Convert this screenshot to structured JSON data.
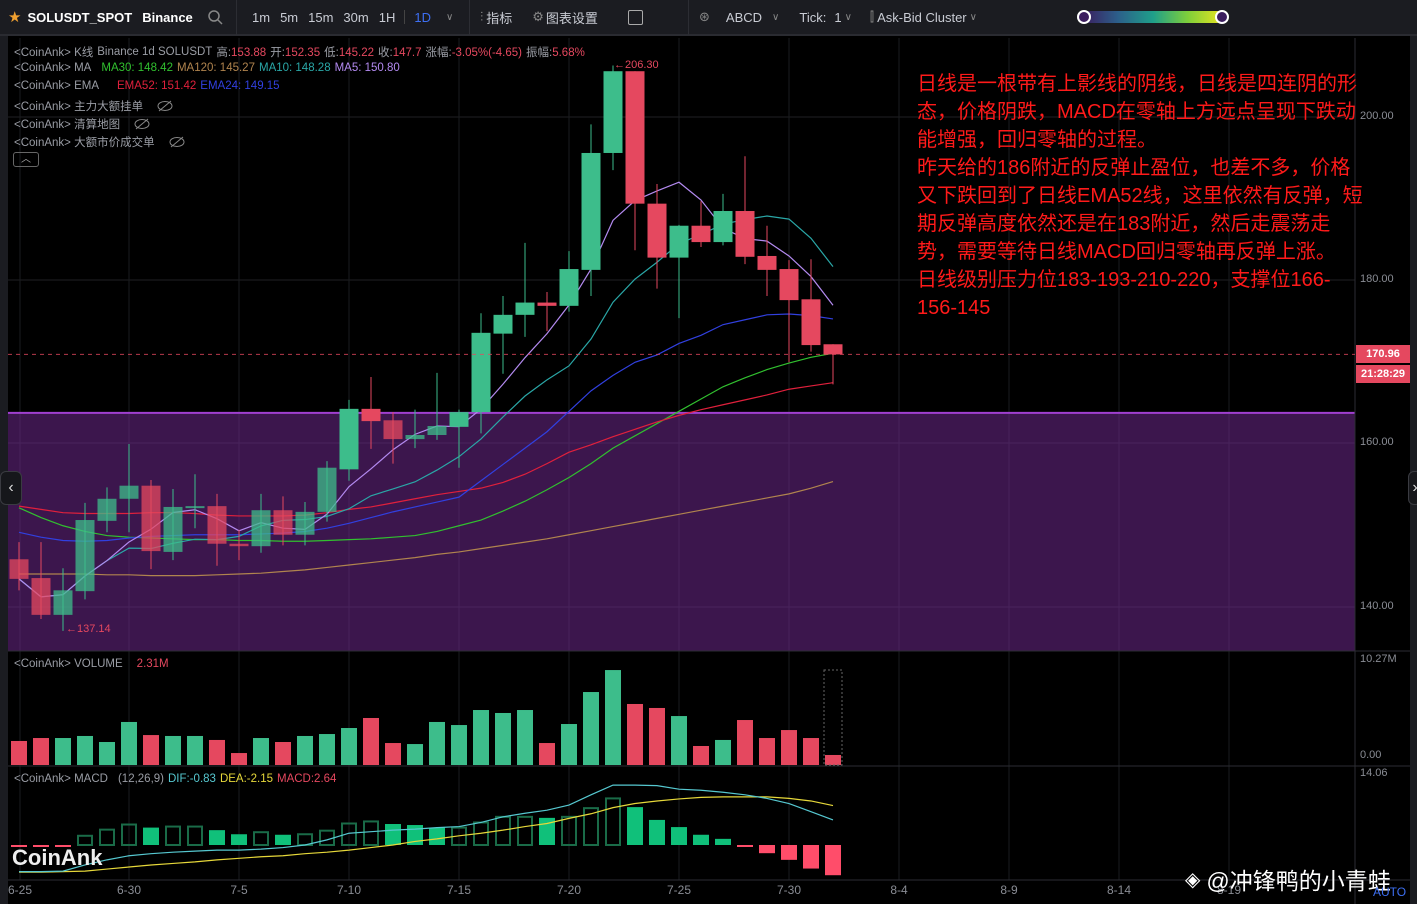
{
  "toolbar": {
    "symbol": "SOLUSDT_SPOT",
    "exchange": "Binance",
    "timeframes": [
      "1m",
      "5m",
      "15m",
      "30m",
      "1H"
    ],
    "active_timeframe": "1D",
    "indicators": "指标",
    "chart_settings": "图表设置",
    "abcd": "ABCD",
    "tick_label": "Tick:",
    "tick_value": "1",
    "cluster": "Ask-Bid Cluster"
  },
  "legend": {
    "kline": {
      "prefix": "<CoinAnk> K线",
      "src": "Binance 1d SOLUSDT",
      "high_l": "高:",
      "high": "153.88",
      "open_l": "开:",
      "open": "152.35",
      "low_l": "低:",
      "low": "145.22",
      "close_l": "收:",
      "close": "147.7",
      "chg_l": "涨幅:",
      "chg": "-3.05%(-4.65)",
      "amp_l": "振幅:",
      "amp": "5.68%"
    },
    "ma": {
      "prefix": "<CoinAnk> MA",
      "ma30": "MA30: 148.42",
      "ma120": "MA120: 145.27",
      "ma10": "MA10: 148.28",
      "ma5": "MA5: 150.80"
    },
    "ema": {
      "prefix": "<CoinAnk> EMA",
      "ema52": "EMA52: 151.42",
      "ema24": "EMA24: 149.15"
    },
    "hidden": [
      "<CoinAnk> 主力大额挂单",
      "<CoinAnk> 清算地图",
      "<CoinAnk> 大额市价成交单"
    ],
    "volume": {
      "prefix": "<CoinAnk> VOLUME",
      "value": "2.31M"
    },
    "macd": {
      "prefix": "<CoinAnk> MACD",
      "params": "(12,26,9)",
      "dif": "DIF:-0.83",
      "dea": "DEA:-2.15",
      "macd": "MACD:2.64"
    }
  },
  "price_axis": [
    "200.00",
    "180.00",
    "160.00",
    "140.00"
  ],
  "volume_axis": [
    "10.27M",
    "0.00"
  ],
  "macd_axis": [
    "14.06"
  ],
  "current_price": "170.96",
  "countdown": "21:28:29",
  "max_marker": "←206.30",
  "min_marker": "←137.14",
  "dates": [
    "6-25",
    "6-30",
    "7-5",
    "7-10",
    "7-15",
    "7-20",
    "7-25",
    "7-30",
    "8-4",
    "8-9",
    "8-14",
    "8-19"
  ],
  "annotation": [
    "日线是一根带有上影线的阴线，日线是四连阴的形态，价格阴跌，MACD在零轴上方远点呈现下跌动能增强，回归零轴的过程。",
    "昨天给的186附近的反弹止盈位，也差不多，价格又下跌回到了日线EMA52线，这里依然有反弹，短期反弹高度依然还是在183附近，然后走震荡走势，需要等待日线MACD回归零轴再反弹上涨。",
    "日线级别压力位183-193-210-220，支撑位166-156-145"
  ],
  "watermark": "CoinAnk",
  "author": "@冲锋鸭的小青蛙",
  "auto": "AUTO",
  "colors": {
    "up": "#3dbd8b",
    "down": "#e5485f",
    "ma5": "#b38af0",
    "ma10": "#2aa7a7",
    "ma30": "#31c02f",
    "ma120": "#b0844e",
    "ema52": "#e0203c",
    "ema24": "#3140e0",
    "dif": "#56c8d0",
    "dea": "#e6d83a",
    "zone": "#a040d0"
  },
  "chart_data": {
    "type": "candlestick",
    "first_date": "6-25",
    "zone_top": 163.8,
    "ohlc": [
      [
        145.9,
        148.0,
        142.1,
        143.5
      ],
      [
        143.6,
        148.0,
        138.6,
        139.1
      ],
      [
        139.1,
        144.8,
        137.14,
        142.1
      ],
      [
        142.0,
        152.8,
        141.0,
        150.7
      ],
      [
        150.6,
        154.7,
        149.2,
        153.3
      ],
      [
        153.3,
        160.0,
        149.2,
        154.9
      ],
      [
        154.9,
        155.6,
        144.7,
        146.9
      ],
      [
        146.8,
        154.5,
        145.8,
        152.3
      ],
      [
        152.4,
        156.3,
        149.7,
        152.4
      ],
      [
        152.4,
        153.9,
        145.1,
        147.8
      ],
      [
        147.8,
        149.5,
        145.8,
        147.5
      ],
      [
        147.5,
        153.9,
        146.7,
        151.9
      ],
      [
        151.9,
        153.6,
        147.6,
        148.9
      ],
      [
        148.9,
        152.9,
        147.6,
        151.7
      ],
      [
        151.7,
        157.9,
        150.5,
        157.1
      ],
      [
        156.9,
        165.4,
        155.5,
        164.3
      ],
      [
        164.3,
        168.2,
        159.4,
        162.8
      ],
      [
        162.9,
        163.9,
        157.6,
        160.6
      ],
      [
        160.6,
        164.2,
        159.5,
        161.1
      ],
      [
        161.1,
        168.7,
        160.5,
        162.2
      ],
      [
        162.1,
        164.2,
        157.1,
        163.9
      ],
      [
        163.9,
        176.0,
        161.3,
        173.6
      ],
      [
        173.5,
        178.1,
        168.6,
        175.8
      ],
      [
        175.8,
        184.6,
        173.1,
        177.3
      ],
      [
        177.3,
        178.6,
        173.8,
        176.9
      ],
      [
        176.9,
        183.6,
        176.2,
        181.4
      ],
      [
        181.3,
        199.1,
        178.1,
        195.6
      ],
      [
        195.6,
        206.3,
        193.5,
        205.6
      ],
      [
        205.6,
        205.6,
        183.7,
        189.4
      ],
      [
        189.4,
        191.8,
        179.0,
        182.8
      ],
      [
        182.8,
        186.8,
        175.4,
        186.7
      ],
      [
        186.7,
        189.7,
        184.1,
        184.7
      ],
      [
        184.7,
        190.6,
        184.3,
        188.5
      ],
      [
        188.5,
        195.2,
        182.0,
        182.9
      ],
      [
        183.0,
        186.7,
        178.1,
        181.3
      ],
      [
        181.4,
        182.5,
        170.0,
        177.6
      ],
      [
        177.7,
        182.6,
        171.3,
        172.1
      ],
      [
        172.2,
        172.2,
        167.3,
        170.96
      ]
    ],
    "volume_m": [
      2.35,
      2.64,
      2.64,
      2.84,
      2.25,
      4.21,
      2.93,
      2.84,
      2.84,
      2.45,
      1.17,
      2.64,
      2.25,
      2.84,
      3.03,
      3.62,
      4.6,
      2.15,
      2.05,
      4.21,
      3.91,
      5.38,
      5.09,
      5.38,
      2.15,
      4.01,
      7.14,
      9.29,
      5.97,
      5.58,
      4.79,
      1.86,
      2.45,
      4.4,
      2.64,
      3.42,
      2.64,
      0.98
    ],
    "ma30": [
      152.2,
      151.0,
      150.0,
      149.3,
      148.8,
      148.6,
      148.5,
      148.4,
      148.3,
      148.3,
      148.2,
      148.2,
      148.1,
      148.1,
      148.2,
      148.3,
      148.4,
      148.6,
      148.8,
      149.3,
      150.0,
      150.7,
      151.8,
      153.0,
      154.4,
      155.9,
      157.6,
      159.5,
      161.0,
      162.5,
      164.0,
      165.5,
      167.0,
      168.1,
      169.1,
      169.9,
      170.6,
      171.1
    ],
    "ma120": [
      144.1,
      144.1,
      144.1,
      144.1,
      144.0,
      144.0,
      143.9,
      143.9,
      143.9,
      144.0,
      144.1,
      144.2,
      144.4,
      144.6,
      144.9,
      145.2,
      145.5,
      145.8,
      146.1,
      146.5,
      146.8,
      147.2,
      147.6,
      148.0,
      148.4,
      148.9,
      149.4,
      149.9,
      150.4,
      150.9,
      151.4,
      151.9,
      152.4,
      152.9,
      153.4,
      153.9,
      154.6,
      155.4
    ],
    "ema52": [
      152.4,
      152.0,
      151.6,
      151.5,
      151.5,
      151.5,
      151.6,
      151.6,
      151.5,
      151.3,
      151.2,
      151.2,
      151.2,
      151.3,
      151.6,
      152.0,
      152.3,
      152.8,
      153.3,
      153.8,
      154.2,
      154.6,
      155.3,
      156.3,
      157.6,
      159.0,
      159.9,
      160.9,
      161.8,
      162.7,
      163.5,
      164.2,
      164.8,
      165.4,
      166.0,
      166.7,
      167.1,
      167.5
    ],
    "ema24": [
      149.2,
      148.6,
      148.2,
      148.1,
      148.2,
      148.5,
      148.7,
      148.8,
      148.9,
      148.9,
      148.9,
      149.0,
      149.1,
      149.3,
      149.7,
      150.3,
      151.0,
      151.7,
      152.3,
      152.9,
      153.5,
      155.5,
      157.5,
      159.5,
      161.5,
      164.0,
      166.5,
      168.4,
      170.0,
      170.9,
      172.3,
      173.3,
      174.6,
      175.2,
      175.8,
      175.9,
      175.7,
      175.3
    ],
    "macd_hist": [
      -0.3,
      -0.3,
      -0.3,
      1.8,
      3.0,
      4.0,
      3.4,
      3.6,
      3.6,
      2.9,
      2.1,
      2.5,
      2.0,
      2.1,
      2.8,
      4.2,
      4.6,
      4.1,
      3.9,
      3.4,
      3.4,
      4.4,
      5.5,
      5.5,
      5.3,
      5.5,
      7.2,
      9.1,
      7.4,
      4.9,
      3.5,
      2.0,
      1.2,
      -0.1,
      -1.6,
      -2.9,
      -4.6,
      -5.9
    ],
    "dif": [
      -5.2,
      -5.2,
      -5.1,
      -3.9,
      -2.9,
      -2.1,
      -1.7,
      -1.4,
      -1.2,
      -1.0,
      -1.0,
      -0.8,
      -0.5,
      0,
      1.0,
      2.3,
      2.6,
      2.9,
      3.1,
      3.4,
      3.6,
      4.4,
      5.5,
      6.2,
      6.8,
      7.8,
      9.8,
      11.7,
      11.7,
      11.6,
      10.9,
      10.7,
      10.3,
      9.8,
      9.1,
      8.1,
      6.5,
      4.9
    ],
    "dea": [
      -5.3,
      -5.3,
      -5.2,
      -5.1,
      -4.7,
      -4.3,
      -3.9,
      -3.6,
      -3.3,
      -2.9,
      -2.6,
      -2.3,
      -2.1,
      -1.7,
      -1.4,
      -1.0,
      -0.5,
      0,
      0.7,
      1.2,
      1.8,
      2.3,
      2.9,
      3.6,
      4.2,
      5.2,
      6.1,
      7.3,
      8.1,
      8.6,
      9.0,
      9.3,
      9.4,
      9.4,
      9.4,
      9.1,
      8.6,
      7.7
    ]
  }
}
